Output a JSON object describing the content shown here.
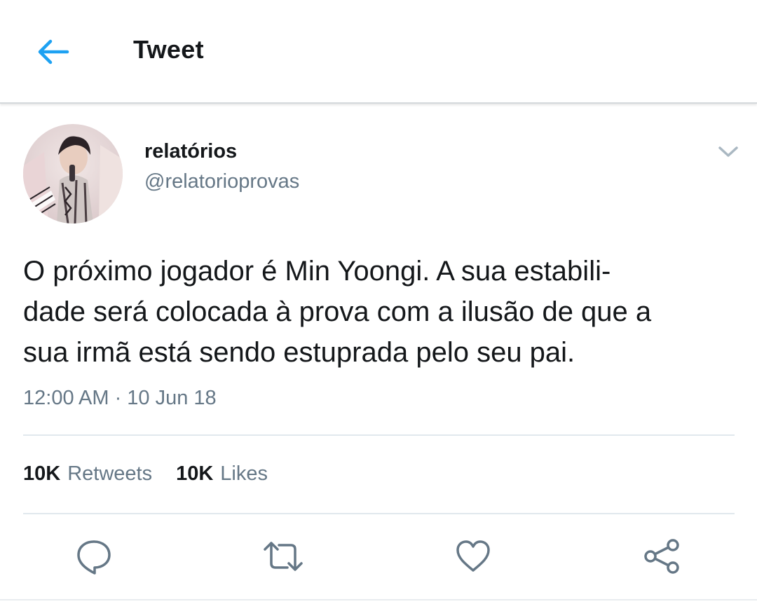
{
  "header": {
    "back_icon": "arrow-left-icon",
    "title": "Tweet",
    "accent_color": "#1da1f2"
  },
  "tweet": {
    "author": {
      "display_name": "relatórios",
      "handle": "@relatorioprovas",
      "avatar": "profile-photo"
    },
    "menu_icon": "chevron-down-icon",
    "text_lines": [
      "O próximo jogador é Min Yoongi. A sua estabili-",
      "dade será colocada à prova com a ilusão de que a",
      "sua irmã está sendo estuprada pelo seu pai."
    ],
    "timestamp": "12:00 AM · 10 Jun 18",
    "stats": {
      "retweets_count": "10K",
      "retweets_label": "Retweets",
      "likes_count": "10K",
      "likes_label": "Likes"
    },
    "actions": [
      "reply-icon",
      "retweet-icon",
      "like-icon",
      "share-icon"
    ]
  },
  "colors": {
    "text_primary": "#14171a",
    "text_secondary": "#657786",
    "divider": "#e1e8ed"
  }
}
